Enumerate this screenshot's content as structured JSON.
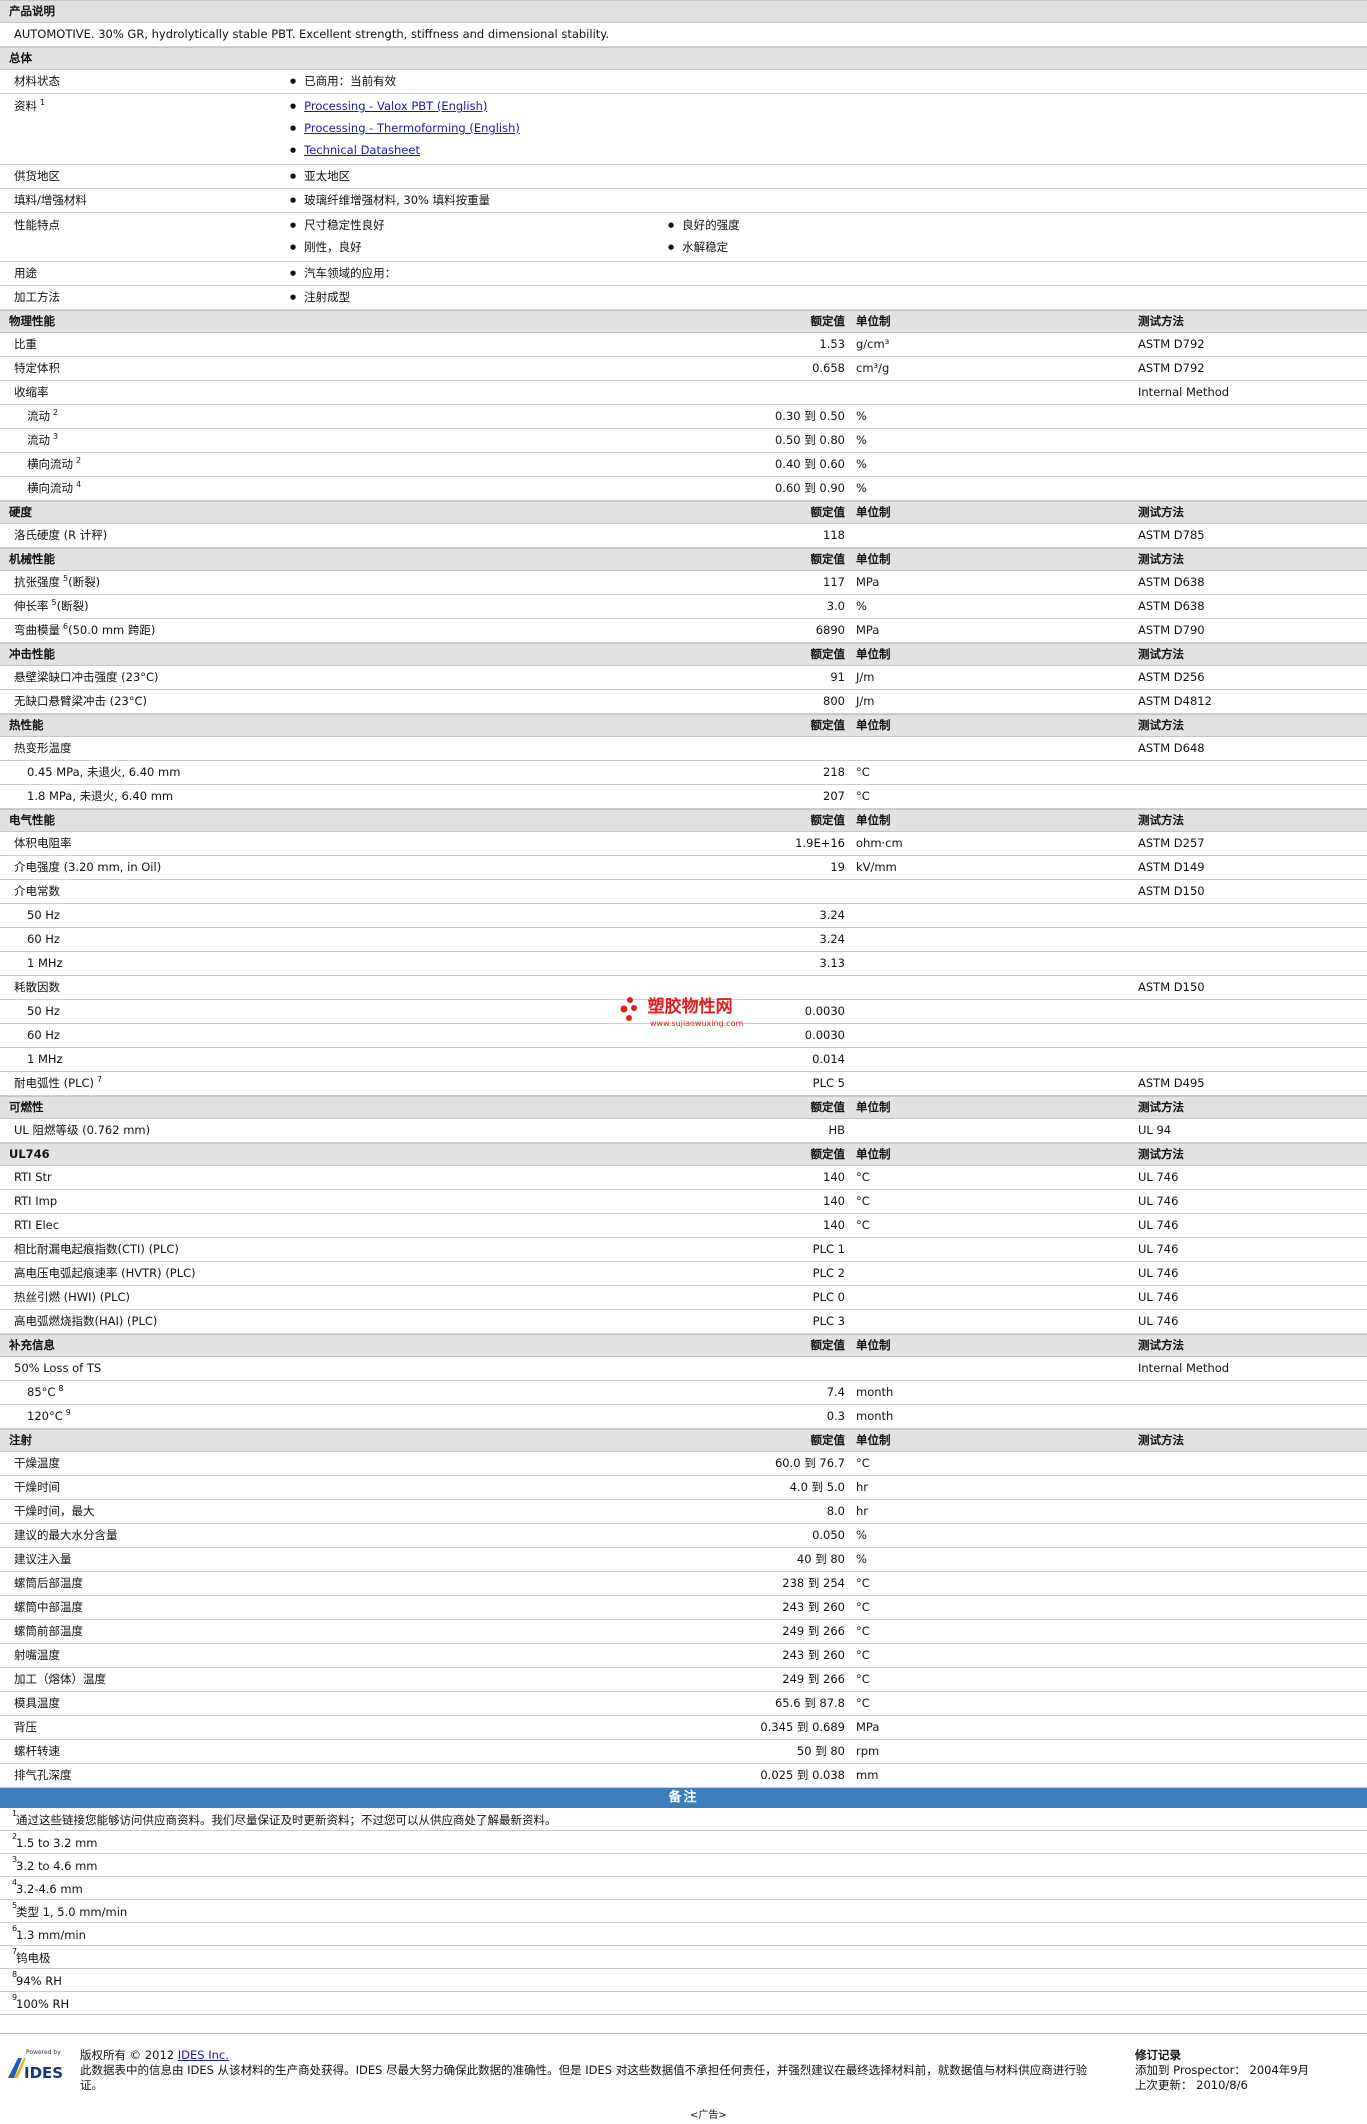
{
  "desc": {
    "title": "产品说明",
    "text": "AUTOMOTIVE. 30% GR, hydrolytically stable PBT. Excellent strength, stiffness and dimensional stability."
  },
  "general": {
    "title": "总体",
    "rows": [
      {
        "label": "材料状态",
        "items": [
          "已商用：当前有效"
        ]
      },
      {
        "label": "资料",
        "sup": "1",
        "links": [
          "Processing - Valox PBT (English)",
          "Processing - Thermoforming (English)",
          "Technical Datasheet"
        ]
      },
      {
        "label": "供货地区",
        "items": [
          "亚太地区"
        ]
      },
      {
        "label": "填料/增强材料",
        "items": [
          "玻璃纤维增强材料, 30% 填料按重量"
        ]
      },
      {
        "label": "性能特点",
        "col1": [
          "尺寸稳定性良好",
          "刚性，良好"
        ],
        "col2": [
          "良好的强度",
          "水解稳定"
        ]
      },
      {
        "label": "用途",
        "items": [
          "汽车领域的应用："
        ]
      },
      {
        "label": "加工方法",
        "items": [
          "注射成型"
        ]
      }
    ]
  },
  "headers": {
    "value": "额定值",
    "unit": "单位制",
    "test": "测试方法"
  },
  "sections": [
    {
      "title": "物理性能",
      "rows": [
        {
          "label": "比重",
          "value": "1.53",
          "unit": "g/cm³",
          "test": "ASTM D792"
        },
        {
          "label": "特定体积",
          "value": "0.658",
          "unit": "cm³/g",
          "test": "ASTM D792"
        },
        {
          "label": "收缩率",
          "test": "Internal Method"
        },
        {
          "label": "流动",
          "sup": "2",
          "indent": true,
          "value": "0.30 到  0.50",
          "unit": "%"
        },
        {
          "label": "流动",
          "sup": "3",
          "indent": true,
          "value": "0.50 到  0.80",
          "unit": "%"
        },
        {
          "label": "横向流动",
          "sup": "2",
          "indent": true,
          "value": "0.40 到  0.60",
          "unit": "%"
        },
        {
          "label": "横向流动",
          "sup": "4",
          "indent": true,
          "value": "0.60 到  0.90",
          "unit": "%"
        }
      ]
    },
    {
      "title": "硬度",
      "rows": [
        {
          "label": "洛氏硬度 (R 计秤)",
          "value": "118",
          "test": "ASTM D785"
        }
      ]
    },
    {
      "title": "机械性能",
      "rows": [
        {
          "label": "抗张强度",
          "sup": "5",
          "suffix": "(断裂)",
          "value": "117",
          "unit": "MPa",
          "test": "ASTM D638"
        },
        {
          "label": "伸长率",
          "sup": "5",
          "suffix": "(断裂)",
          "value": "3.0",
          "unit": "%",
          "test": "ASTM D638"
        },
        {
          "label": "弯曲模量",
          "sup": "6",
          "suffix": "(50.0 mm 跨距)",
          "value": "6890",
          "unit": "MPa",
          "test": "ASTM D790"
        }
      ]
    },
    {
      "title": "冲击性能",
      "rows": [
        {
          "label": "悬壁梁缺口冲击强度 (23°C)",
          "value": "91",
          "unit": "J/m",
          "test": "ASTM D256"
        },
        {
          "label": "无缺口悬臂梁冲击 (23°C)",
          "value": "800",
          "unit": "J/m",
          "test": "ASTM D4812"
        }
      ]
    },
    {
      "title": "热性能",
      "rows": [
        {
          "label": "热变形温度",
          "test": "ASTM D648"
        },
        {
          "label": "0.45 MPa, 未退火, 6.40 mm",
          "indent": true,
          "value": "218",
          "unit": "°C"
        },
        {
          "label": "1.8 MPa, 未退火, 6.40 mm",
          "indent": true,
          "value": "207",
          "unit": "°C"
        }
      ]
    },
    {
      "title": "电气性能",
      "rows": [
        {
          "label": "体积电阻率",
          "value": "1.9E+16",
          "unit": "ohm·cm",
          "test": "ASTM D257"
        },
        {
          "label": "介电强度 (3.20 mm, in Oil)",
          "value": "19",
          "unit": "kV/mm",
          "test": "ASTM D149"
        },
        {
          "label": "介电常数",
          "test": "ASTM D150"
        },
        {
          "label": "50 Hz",
          "indent": true,
          "value": "3.24"
        },
        {
          "label": "60 Hz",
          "indent": true,
          "value": "3.24"
        },
        {
          "label": "1 MHz",
          "indent": true,
          "value": "3.13"
        },
        {
          "label": "耗散因数",
          "test": "ASTM D150"
        },
        {
          "label": "50 Hz",
          "indent": true,
          "value": "0.0030"
        },
        {
          "label": "60 Hz",
          "indent": true,
          "value": "0.0030"
        },
        {
          "label": "1 MHz",
          "indent": true,
          "value": "0.014"
        },
        {
          "label": "耐电弧性 (PLC)",
          "sup": "7",
          "value": "PLC 5",
          "test": "ASTM D495"
        }
      ]
    },
    {
      "title": "可燃性",
      "rows": [
        {
          "label": "UL 阻燃等级 (0.762 mm)",
          "value": "HB",
          "test": "UL 94"
        }
      ]
    },
    {
      "title": "UL746",
      "rows": [
        {
          "label": "RTI Str",
          "value": "140",
          "unit": "°C",
          "test": "UL 746"
        },
        {
          "label": "RTI Imp",
          "value": "140",
          "unit": "°C",
          "test": "UL 746"
        },
        {
          "label": "RTI Elec",
          "value": "140",
          "unit": "°C",
          "test": "UL 746"
        },
        {
          "label": "相比耐漏电起痕指数(CTI) (PLC)",
          "value": "PLC 1",
          "test": "UL 746"
        },
        {
          "label": "高电压电弧起痕速率 (HVTR) (PLC)",
          "value": "PLC 2",
          "test": "UL 746"
        },
        {
          "label": "热丝引燃 (HWI) (PLC)",
          "value": "PLC 0",
          "test": "UL 746"
        },
        {
          "label": "高电弧燃烧指数(HAI) (PLC)",
          "value": "PLC 3",
          "test": "UL 746"
        }
      ]
    },
    {
      "title": "补充信息",
      "rows": [
        {
          "label": "50% Loss of TS",
          "test": "Internal Method"
        },
        {
          "label": "85°C",
          "sup": "8",
          "indent": true,
          "value": "7.4",
          "unit": "month"
        },
        {
          "label": "120°C",
          "sup": "9",
          "indent": true,
          "value": "0.3",
          "unit": "month"
        }
      ]
    },
    {
      "title": "注射",
      "rows": [
        {
          "label": "干燥温度",
          "value": "60.0 到  76.7",
          "unit": "°C"
        },
        {
          "label": "干燥时间",
          "value": "4.0 到  5.0",
          "unit": "hr"
        },
        {
          "label": "干燥时间，最大",
          "value": "8.0",
          "unit": "hr"
        },
        {
          "label": "建议的最大水分含量",
          "value": "0.050",
          "unit": "%"
        },
        {
          "label": "建议注入量",
          "value": "40 到  80",
          "unit": "%"
        },
        {
          "label": "螺筒后部温度",
          "value": "238 到  254",
          "unit": "°C"
        },
        {
          "label": "螺筒中部温度",
          "value": "243 到  260",
          "unit": "°C"
        },
        {
          "label": "螺筒前部温度",
          "value": "249 到  266",
          "unit": "°C"
        },
        {
          "label": "射嘴温度",
          "value": "243 到  260",
          "unit": "°C"
        },
        {
          "label": "加工（熔体）温度",
          "value": "249 到  266",
          "unit": "°C"
        },
        {
          "label": "模具温度",
          "value": "65.6 到  87.8",
          "unit": "°C"
        },
        {
          "label": "背压",
          "value": "0.345 到  0.689",
          "unit": "MPa"
        },
        {
          "label": "螺杆转速",
          "value": "50 到  80",
          "unit": "rpm"
        },
        {
          "label": "排气孔深度",
          "value": "0.025 到  0.038",
          "unit": "mm"
        }
      ]
    }
  ],
  "notes": {
    "title": "备注",
    "items": [
      {
        "n": "1",
        "text": "通过这些链接您能够访问供应商资料。我们尽量保证及时更新资料；不过您可以从供应商处了解最新资料。"
      },
      {
        "n": "2",
        "text": "1.5 to 3.2 mm"
      },
      {
        "n": "3",
        "text": "3.2 to 4.6 mm"
      },
      {
        "n": "4",
        "text": "3.2-4.6 mm"
      },
      {
        "n": "5",
        "text": "类型  1, 5.0 mm/min"
      },
      {
        "n": "6",
        "text": "1.3 mm/min"
      },
      {
        "n": "7",
        "text": "钨电极"
      },
      {
        "n": "8",
        "text": "94% RH"
      },
      {
        "n": "9",
        "text": "100% RH"
      }
    ]
  },
  "footer": {
    "powered": "Powered by",
    "brand": "IDES",
    "copyright": "版权所有 © 2012",
    "company": "IDES Inc.",
    "disclaimer": "此数据表中的信息由 IDES 从该材料的生产商处获得。IDES 尽最大努力确保此数据的准确性。但是 IDES 对这些数据值不承担任何责任，并强烈建议在最终选择材料前，就数据值与材料供应商进行验证。",
    "rev_title": "修订记录",
    "rev_added": "添加到 Prospector：  2004年9月",
    "rev_updated": "上次更新：  2010/8/6",
    "ad": "<广告>"
  },
  "watermark": {
    "name": "塑胶物性网",
    "url": "www.sujiaowuxing.com",
    "color": "#e02020"
  }
}
